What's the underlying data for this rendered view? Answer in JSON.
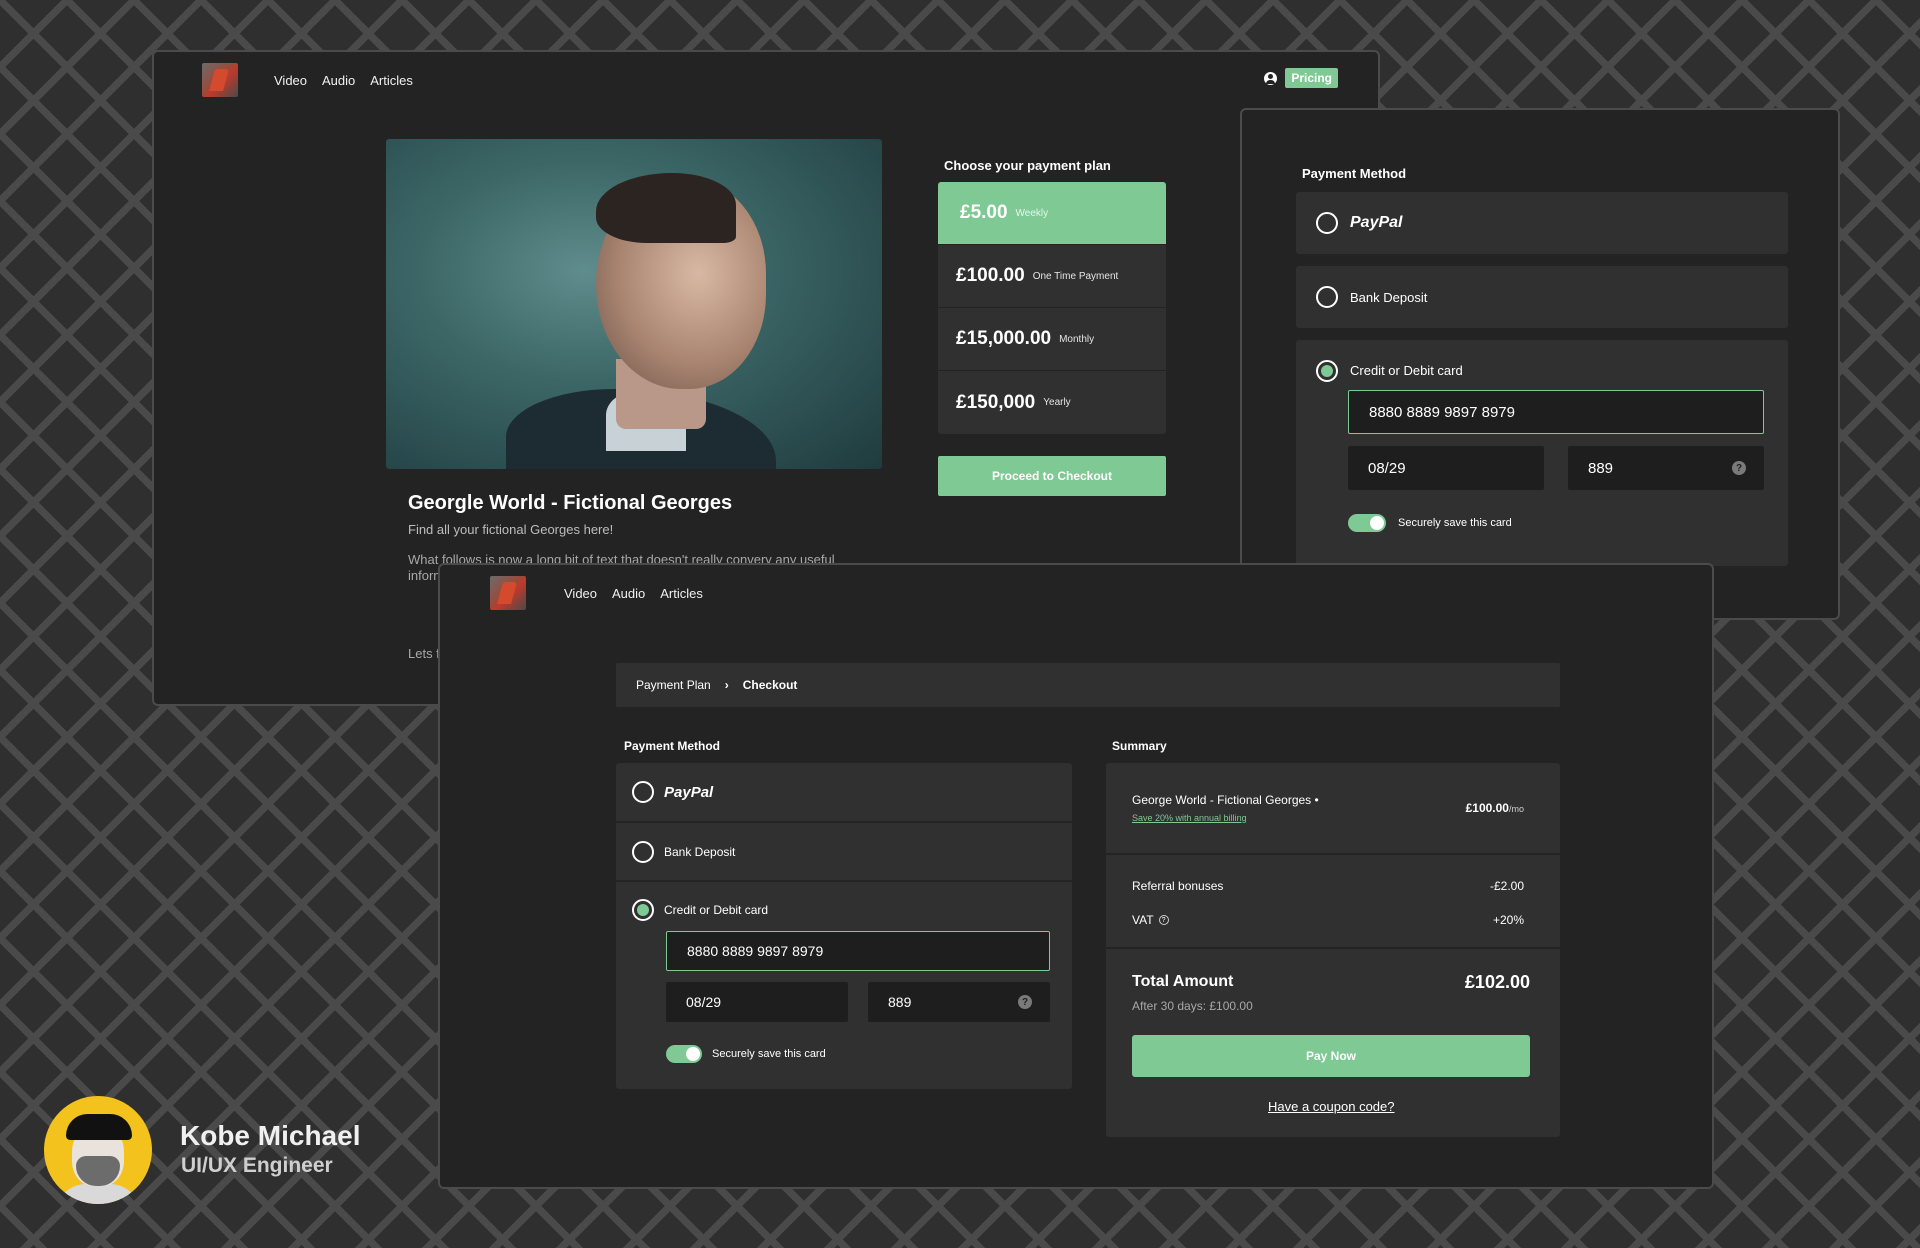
{
  "back_window": {
    "nav": {
      "links": [
        "Video",
        "Audio",
        "Articles"
      ],
      "pricing_label": "Pricing"
    },
    "article": {
      "title": "Georgle World - Fictional Georges",
      "subtitle": "Find all your fictional Georges here!",
      "body": "What follows is now a long bit of text that doesn't really convery any useful inform shows trunca certai",
      "closing": "Lets f"
    },
    "plans": {
      "heading": "Choose your payment plan",
      "items": [
        {
          "price": "£5.00",
          "period": "Weekly",
          "selected": true
        },
        {
          "price": "£100.00",
          "period": "One Time Payment",
          "selected": false
        },
        {
          "price": "£15,000.00",
          "period": "Monthly",
          "selected": false
        },
        {
          "price": "£150,000",
          "period": "Yearly",
          "selected": false
        }
      ],
      "checkout_label": "Proceed to Checkout"
    }
  },
  "payment_card": {
    "title": "Payment Method",
    "options": {
      "paypal": "PayPal",
      "bank": "Bank Deposit",
      "card": "Credit or Debit card"
    },
    "card_number": "8880  8889  9897  8979",
    "expiry": "08/29",
    "cvc": "889",
    "help_glyph": "?",
    "save_card_label": "Securely save this card"
  },
  "checkout": {
    "nav": {
      "links": [
        "Video",
        "Audio",
        "Articles"
      ]
    },
    "breadcrumb": {
      "parent": "Payment Plan",
      "separator": "›",
      "current": "Checkout"
    },
    "payment": {
      "title": "Payment Method",
      "options": {
        "paypal": "PayPal",
        "bank": "Bank Deposit",
        "card": "Credit or Debit card"
      },
      "card_number": "8880  8889  9897  8979",
      "expiry": "08/29",
      "cvc": "889",
      "help_glyph": "?",
      "save_card_label": "Securely save this card"
    },
    "summary": {
      "title": "Summary",
      "product": "George World - Fictional Georges •",
      "annual_offer": "Save 20% with annual billing",
      "product_price": "£100.00",
      "product_unit": "/mo",
      "referral_label": "Referral bonuses",
      "referral_value": "-£2.00",
      "vat_label": "VAT",
      "vat_info_glyph": "?",
      "vat_value": "+20%",
      "total_label": "Total Amount",
      "total_value": "£102.00",
      "after_note": "After 30 days: £100.00",
      "pay_label": "Pay Now",
      "coupon_label": "Have a coupon code?"
    }
  },
  "author": {
    "name": "Kobe Michael",
    "role": "UI/UX Engineer"
  },
  "colors": {
    "accent": "#7ec994",
    "background": "#2f2f2f",
    "panel": "#232323",
    "card": "#303030"
  }
}
